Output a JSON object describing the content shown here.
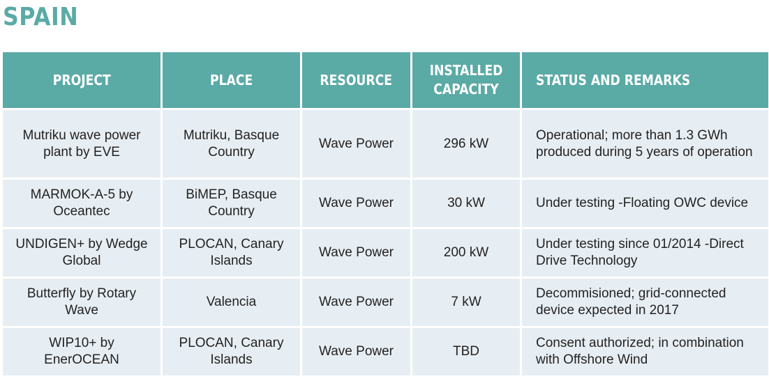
{
  "page_title": "SPAIN",
  "table": {
    "headers": [
      "PROJECT",
      "PLACE",
      "RESOURCE",
      "INSTALLED CAPACITY",
      "STATUS AND REMARKS"
    ],
    "rows": [
      [
        "Mutriku wave power plant by EVE",
        "Mutriku, Basque Country",
        "Wave Power",
        "296 kW",
        "Operational; more than 1.3 GWh produced during 5 years of operation"
      ],
      [
        "MARMOK-A-5 by Oceantec",
        "BiMEP, Basque Country",
        "Wave Power",
        "30 kW",
        "Under testing -Floating OWC device"
      ],
      [
        "UNDIGEN+ by Wedge Global",
        "PLOCAN, Canary Islands",
        "Wave Power",
        "200 kW",
        "Under testing since 01/2014 -Direct Drive Technology"
      ],
      [
        "Butterfly by Rotary Wave",
        "Valencia",
        "Wave Power",
        "7 kW",
        "Decommisioned; grid-connected device expected in 2017"
      ],
      [
        "WIP10+ by EnerOCEAN",
        "PLOCAN, Canary Islands",
        "Wave Power",
        "TBD",
        "Consent authorized; in combination with Offshore Wind"
      ]
    ]
  }
}
